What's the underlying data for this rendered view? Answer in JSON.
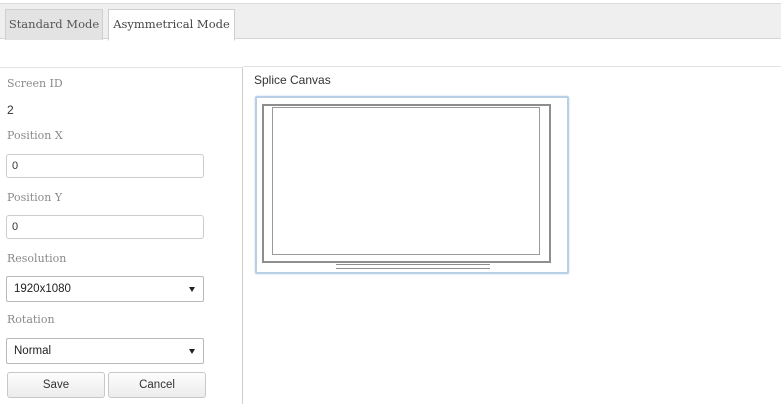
{
  "tabs": [
    {
      "label": "Standard Mode",
      "active": false
    },
    {
      "label": "Asymmetrical Mode",
      "active": true
    }
  ],
  "form": {
    "screen_id_label": "Screen ID",
    "screen_id_value": "2",
    "position_x_label": "Position X",
    "position_x_value": "0",
    "position_y_label": "Position Y",
    "position_y_value": "0",
    "resolution_label": "Resolution",
    "resolution_value": "1920x1080",
    "rotation_label": "Rotation",
    "rotation_value": "Normal",
    "save_label": "Save",
    "cancel_label": "Cancel"
  },
  "canvas": {
    "title": "Splice Canvas",
    "screens": [
      {
        "screen_id": "2",
        "icon": "monitor-icon"
      }
    ]
  },
  "colors": {
    "canvas_border": "#b9cfe6",
    "screen_outline": "#8e8e8e",
    "tab_bar_bg": "#efefef"
  }
}
